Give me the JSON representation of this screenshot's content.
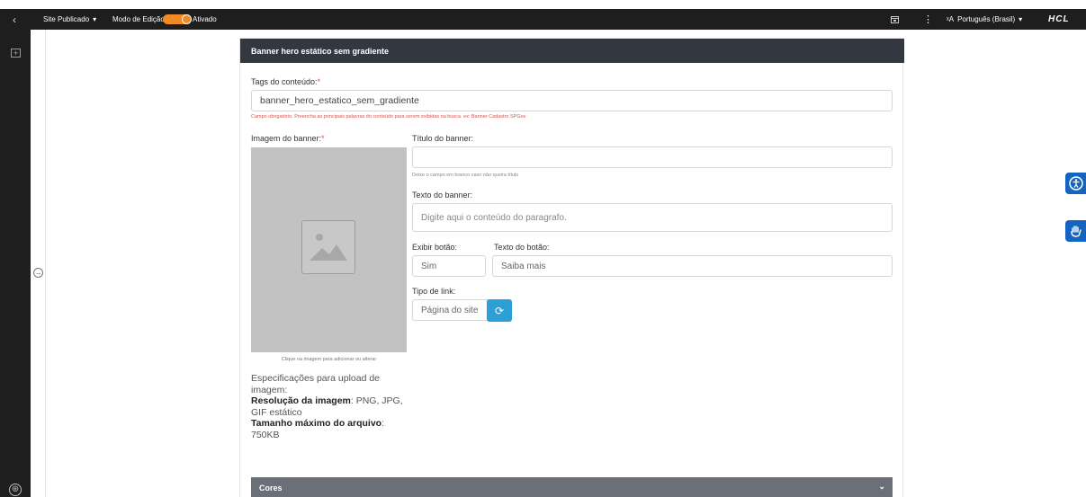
{
  "topbar": {
    "back_icon": "chevron-left-icon",
    "site_status": "Site Publicado",
    "site_caret": "▾",
    "edit_mode_label": "Modo de Edição:",
    "edit_mode_state": "Ativado",
    "toggle_on": true,
    "language": "Português (Brasil)",
    "language_caret": "▾",
    "logo": "HCL",
    "accent_color": "#f08a24"
  },
  "card": {
    "title": "Banner hero estático sem gradiente",
    "tags": {
      "label": "Tags do conteúdo:",
      "required_mark": "*",
      "value": "banner_hero_estatico_sem_gradiente",
      "help": "Campo obrigatório. Preencha as principais palavras do conteúdo para serem exibidas na busca. ex: Banner Cadastro SPGov"
    },
    "image": {
      "label": "Imagem do banner:",
      "required_mark": "*",
      "caption": "Clique na imagem para adicionar ou alterar",
      "icon": "image-placeholder-icon"
    },
    "specs": {
      "intro": "Especificações para upload de imagem:",
      "resolution_label": "Resolução da imagem",
      "resolution_value": ": PNG, JPG, GIF estático",
      "size_label": "Tamanho máximo do arquivo",
      "size_value": ": 750KB"
    },
    "banner_title": {
      "label": "Título do banner:",
      "value": "",
      "help": "Deixe o campo em branco caso não queira título"
    },
    "banner_text": {
      "label": "Texto do banner:",
      "placeholder": "Digite aqui o conteúdo do paragrafo."
    },
    "show_button": {
      "label": "Exibir botão:",
      "value": "Sim"
    },
    "button_text": {
      "label": "Texto do botão:",
      "value": "Saiba mais"
    },
    "link_type": {
      "label": "Tipo de link:",
      "value": "Página do site",
      "refresh_icon": "refresh-icon",
      "button_color": "#2b9fd6"
    },
    "colors_section": {
      "title": "Cores",
      "chevron": "⌄"
    }
  },
  "side": {
    "accessibility_icon": "accessibility-icon",
    "sign_language_icon": "sign-language-icon"
  }
}
